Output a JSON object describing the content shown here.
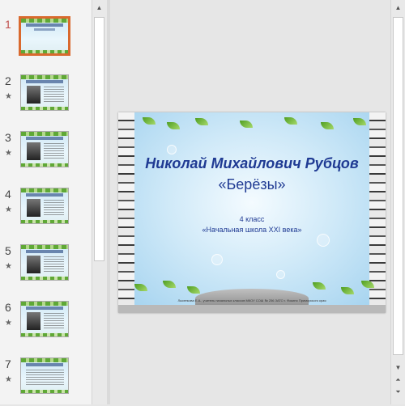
{
  "thumbnails": [
    {
      "number": "1",
      "active": true,
      "has_transition": false
    },
    {
      "number": "2",
      "active": false,
      "has_transition": true
    },
    {
      "number": "3",
      "active": false,
      "has_transition": true
    },
    {
      "number": "4",
      "active": false,
      "has_transition": true
    },
    {
      "number": "5",
      "active": false,
      "has_transition": true
    },
    {
      "number": "6",
      "active": false,
      "has_transition": true
    },
    {
      "number": "7",
      "active": false,
      "has_transition": true
    }
  ],
  "transition_icon": "star-icon",
  "slide": {
    "title": "Николай Михайлович Рубцов",
    "subtitle": "«Берёзы»",
    "grade": "4 класс",
    "school": "«Начальная школа XXI века»",
    "footer": "Лысенкова Е.А., учитель начальных классов МКОУ СОШ № 256 ЗАТО г. Фокино Приморского края"
  },
  "colors": {
    "active_thumb_border": "#d9692e",
    "active_number": "#c0504d",
    "title_text": "#1f3a93"
  },
  "scrollbar_icons": {
    "up": "scroll-up-icon",
    "down": "scroll-down-icon",
    "page_up": "page-up-icon",
    "page_down": "page-down-icon"
  }
}
